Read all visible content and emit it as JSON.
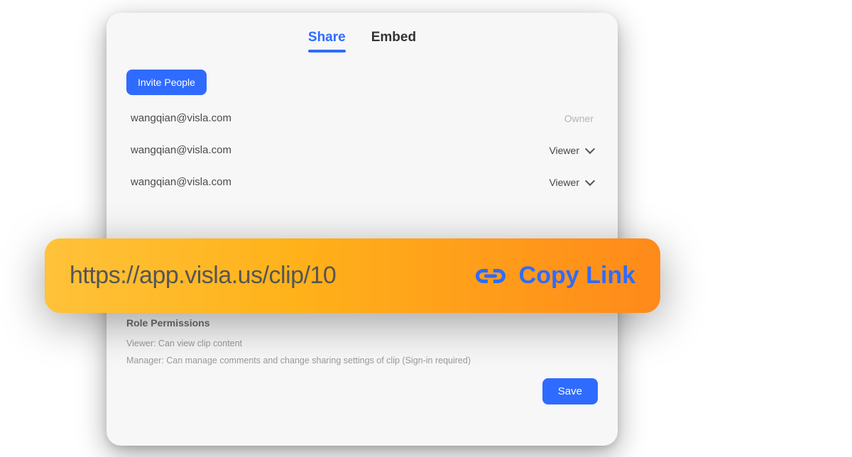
{
  "tabs": {
    "share": "Share",
    "embed": "Embed"
  },
  "invite_button": "Invite People",
  "people": [
    {
      "email": "wangqian@visla.com",
      "role": "Owner",
      "editable": false
    },
    {
      "email": "wangqian@visla.com",
      "role": "Viewer",
      "editable": true
    },
    {
      "email": "wangqian@visla.com",
      "role": "Viewer",
      "editable": true
    }
  ],
  "link": {
    "url": "https://app.visla.us/clip/10",
    "copy_label": "Copy Link"
  },
  "role_permissions": {
    "title": "Role Permissions",
    "viewer_line": "Viewer: Can view clip content",
    "manager_line": "Manager: Can manage comments and change sharing settings of clip (Sign-in required)"
  },
  "save_button": "Save"
}
